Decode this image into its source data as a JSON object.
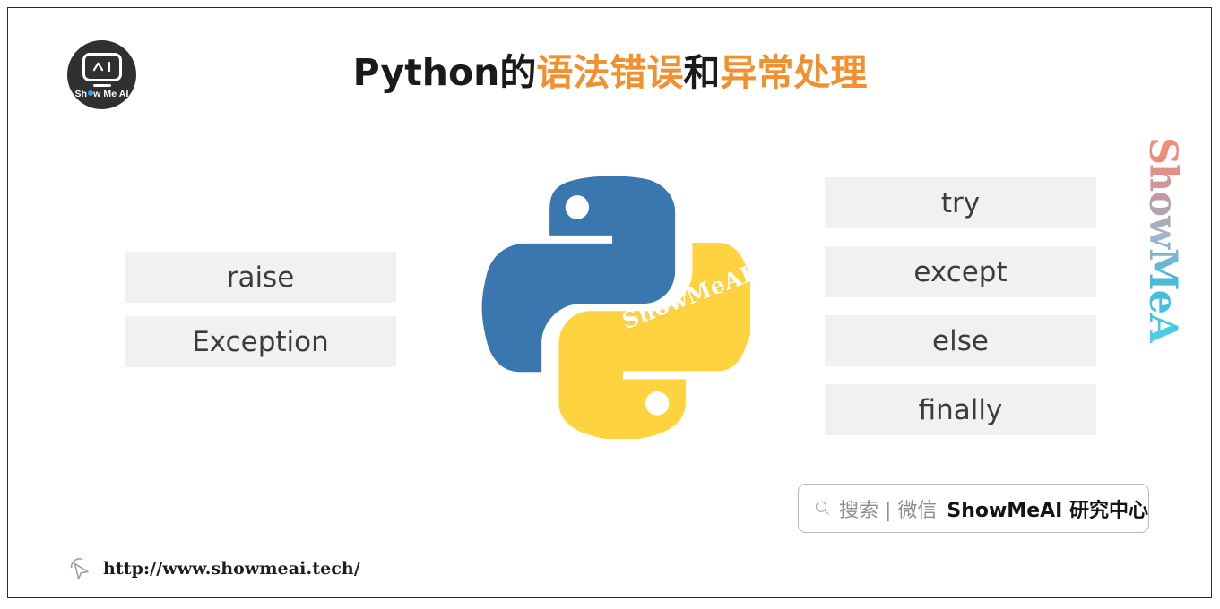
{
  "slide": {
    "background_color": "#ffffff",
    "border_color": "#2b2b2b"
  },
  "logo": {
    "name": "Show Me AI",
    "text_before_dot": "Sh",
    "text_after_dot": "w Me AI",
    "icon": "robot-face-icon",
    "background_color": "#2f3032",
    "dot_color": "#27a7e5"
  },
  "title": {
    "full": "Python的语法错误和异常处理",
    "segments": [
      {
        "text": "Python的",
        "color": "#1a1a1a"
      },
      {
        "text": "语法错误",
        "color": "#f0902f"
      },
      {
        "text": "和",
        "color": "#1a1a1a"
      },
      {
        "text": "异常处理",
        "color": "#f0902f"
      }
    ],
    "part_1": "Python的",
    "part_2": "语法错误",
    "part_3": "和",
    "part_4": "异常处理"
  },
  "left_column": {
    "items": [
      {
        "label": "raise"
      },
      {
        "label": "Exception"
      }
    ]
  },
  "right_column": {
    "items": [
      {
        "label": "try"
      },
      {
        "label": "except"
      },
      {
        "label": "else"
      },
      {
        "label": "finally"
      }
    ]
  },
  "python_logo": {
    "icon": "python-logo-icon",
    "blue": "#3b77af",
    "yellow": "#ffd23f",
    "watermark": "ShowMeAI"
  },
  "vertical_brand": {
    "text": "ShowMeAI",
    "gradient_start": "#f0907a",
    "gradient_end": "#4fc3e4"
  },
  "search_pill": {
    "icon": "search-icon",
    "light_text": "搜索 | 微信",
    "bold_text": "ShowMeAI 研究中心",
    "border_color": "#b9b9b9"
  },
  "footer": {
    "icon": "cursor-pointer-icon",
    "url": "http://www.showmeai.tech/"
  },
  "box_style": {
    "fill": "#f1f1f1",
    "text_color": "#3c3c3c"
  }
}
